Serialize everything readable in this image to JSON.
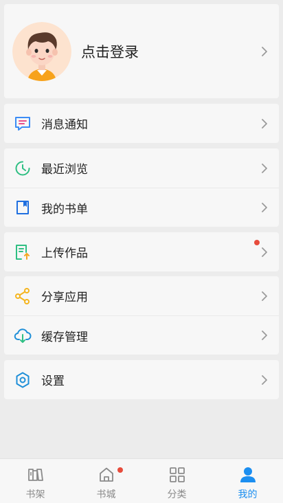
{
  "profile": {
    "login_label": "点击登录"
  },
  "menu": {
    "notifications": "消息通知",
    "recent": "最近浏览",
    "booklist": "我的书单",
    "upload": "上传作品",
    "share": "分享应用",
    "cache": "缓存管理",
    "settings": "设置"
  },
  "icons": {
    "notifications": "message-icon",
    "recent": "clock-icon",
    "booklist": "bookmark-icon",
    "upload": "upload-document-icon",
    "share": "share-icon",
    "cache": "cloud-download-icon",
    "settings": "gear-icon"
  },
  "tabs": [
    {
      "label": "书架",
      "icon": "bookshelf-icon",
      "active": false
    },
    {
      "label": "书城",
      "icon": "home-icon",
      "active": false,
      "badge": true
    },
    {
      "label": "分类",
      "icon": "grid-icon",
      "active": false
    },
    {
      "label": "我的",
      "icon": "user-icon",
      "active": true
    }
  ],
  "colors": {
    "accent": "#1b8ef0",
    "badge": "#e74c3c",
    "inactive_tab": "#8a8a8a",
    "message_icon": "#3b8cf5",
    "clock_icon": "#2fbf83",
    "bookmark_icon": "#1f6fe0",
    "upload_icon": "#2fbf83",
    "share_icon": "#f5b51e",
    "cloud_icon": "#1f8fd8",
    "settings_icon": "#1f8fd8"
  }
}
